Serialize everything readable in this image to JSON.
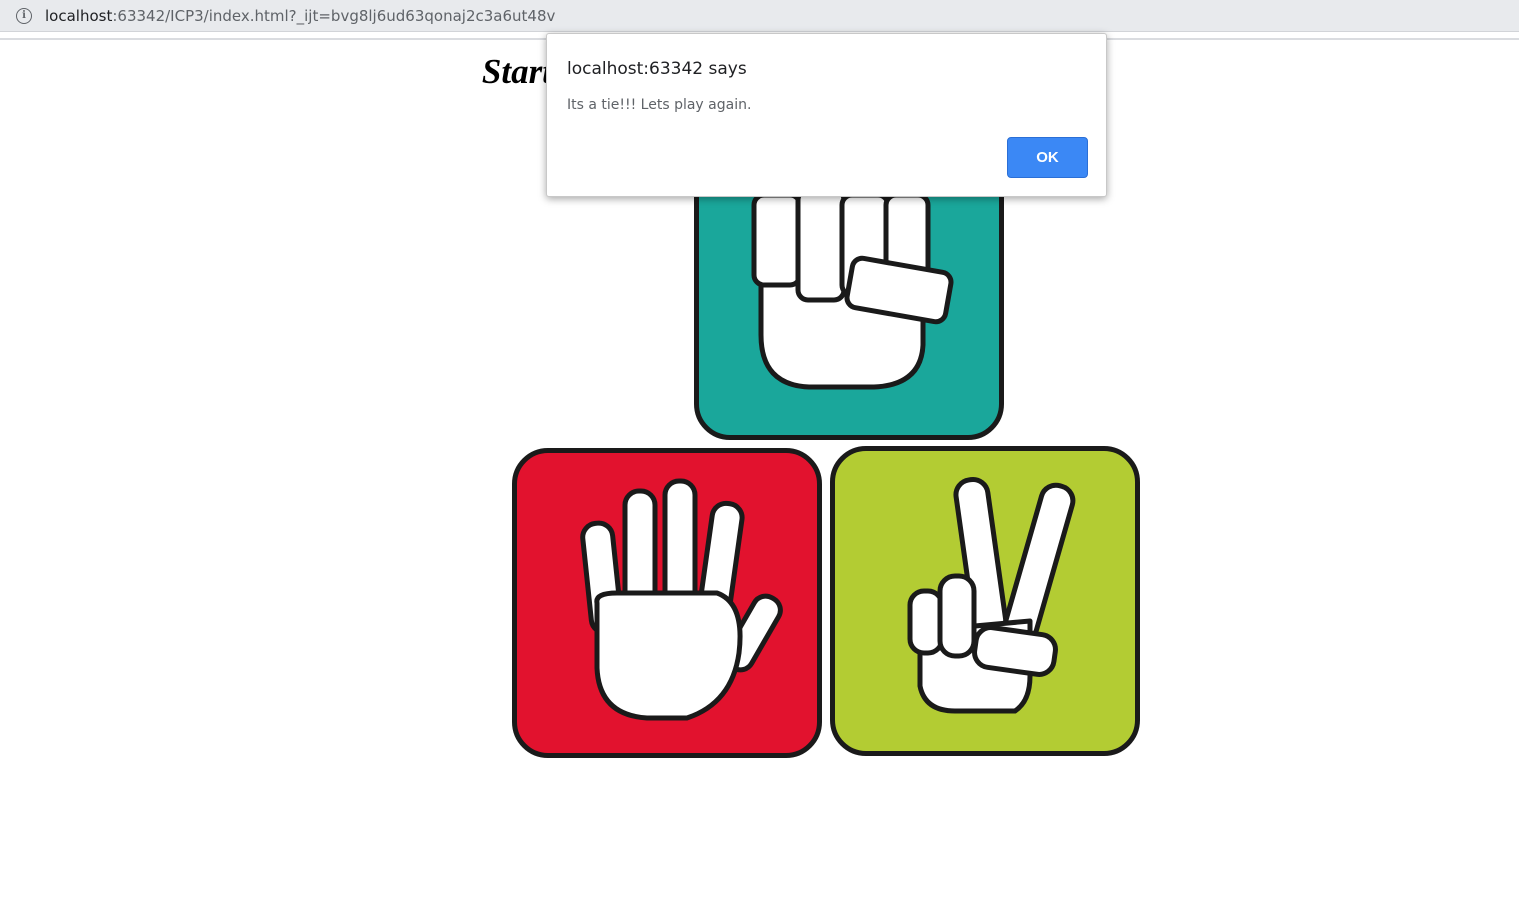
{
  "browser": {
    "url_host": "localhost",
    "url_rest": ":63342/ICP3/index.html?_ijt=bvg8lj6ud63qonaj2c3a6ut48v",
    "info_icon": "info-icon"
  },
  "page": {
    "heading": "Start the game: Rock Paper Scissors..!"
  },
  "tiles": [
    {
      "name": "rock",
      "icon": "fist-icon",
      "color": "#1aa79b"
    },
    {
      "name": "paper",
      "icon": "open-hand-icon",
      "color": "#e2122e"
    },
    {
      "name": "scissors",
      "icon": "peace-hand-icon",
      "color": "#b3cc33"
    }
  ],
  "dialog": {
    "title": "localhost:63342 says",
    "message": "Its a tie!!! Lets play again.",
    "ok_label": "OK",
    "button_color": "#3b88f5"
  }
}
